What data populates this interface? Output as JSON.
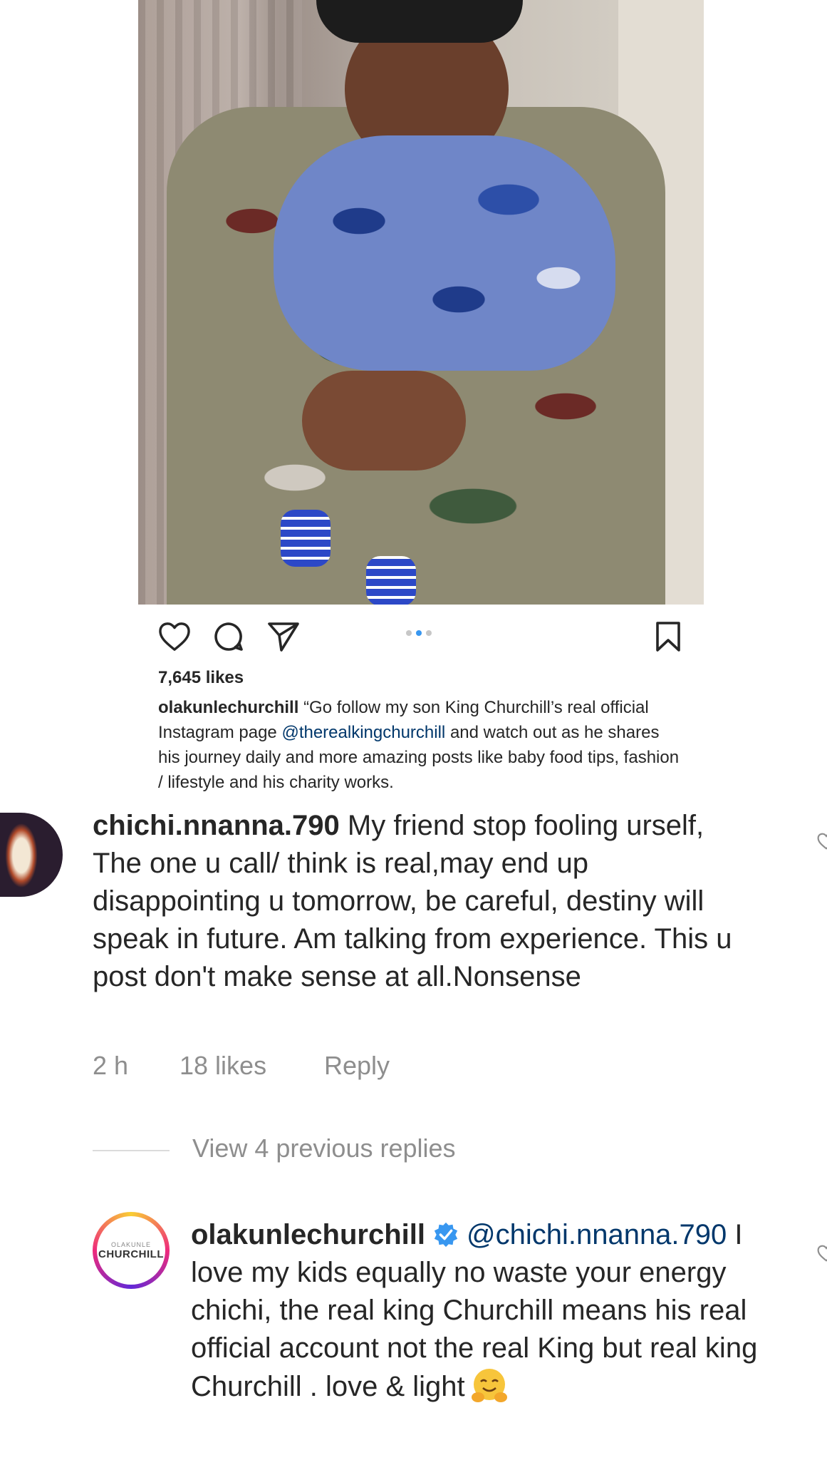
{
  "post": {
    "likes": "7,645 likes",
    "caption_user": "olakunlechurchill",
    "caption_text_1": "“Go follow my son King Churchill’s real official Instagram page",
    "caption_mention": "@therealkingchurchill",
    "caption_text_2": "and watch out as he shares his journey daily and more amazing posts like baby food tips, fashion / lifestyle and his charity works."
  },
  "comment": {
    "user": "chichi.nnanna.790",
    "text": "My friend  stop fooling urself, The one u call/ think is real,may end up disappointing u tomorrow, be careful, destiny will speak in future. Am talking from experience. This u post don't make sense at all.Nonsense",
    "time": "2 h",
    "likes": "18 likes",
    "reply_label": "Reply"
  },
  "view_replies": "View 4 previous replies",
  "reply": {
    "user": "olakunlechurchill",
    "mention": "@chichi.nnanna.790",
    "text": "I love my kids equally no waste your energy chichi, the real king Churchill means his real official  account not the real King but real king Churchill . love & light",
    "avatar_logo_top": "OLAKUNLE",
    "avatar_logo_main": "CHURCHILL"
  },
  "icons": [
    "heart-icon",
    "comment-icon",
    "share-icon",
    "bookmark-icon",
    "verified-icon",
    "hug-emoji-icon"
  ],
  "colors": {
    "mention": "#00376b",
    "meta": "#8e8e8e",
    "active_dot": "#3897f0",
    "verified": "#3897f0"
  }
}
